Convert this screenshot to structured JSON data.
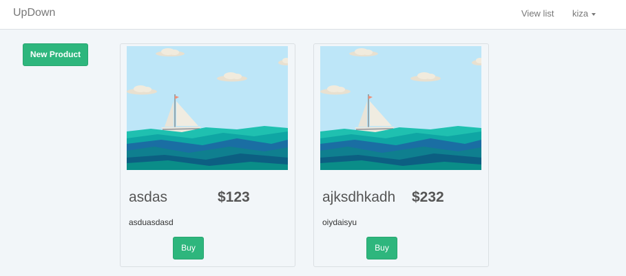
{
  "navbar": {
    "brand": "UpDown",
    "view_list": "View list",
    "user": "kiza"
  },
  "actions": {
    "new_product_label": "New Product"
  },
  "products": [
    {
      "name": "asdas",
      "price": "$123",
      "description": "asduasdasd",
      "buy_label": "Buy",
      "image": "sailboat-illustration"
    },
    {
      "name": "ajksdhkadh",
      "price": "$232",
      "description": "oiydaisyu",
      "buy_label": "Buy",
      "image": "sailboat-illustration"
    }
  ],
  "colors": {
    "brand_green": "#2eb67d",
    "page_bg": "#f2f6f9",
    "sky": "#bde6f8",
    "sea_teal": "#0fa6a4",
    "sea_blue": "#1a6ea3"
  }
}
